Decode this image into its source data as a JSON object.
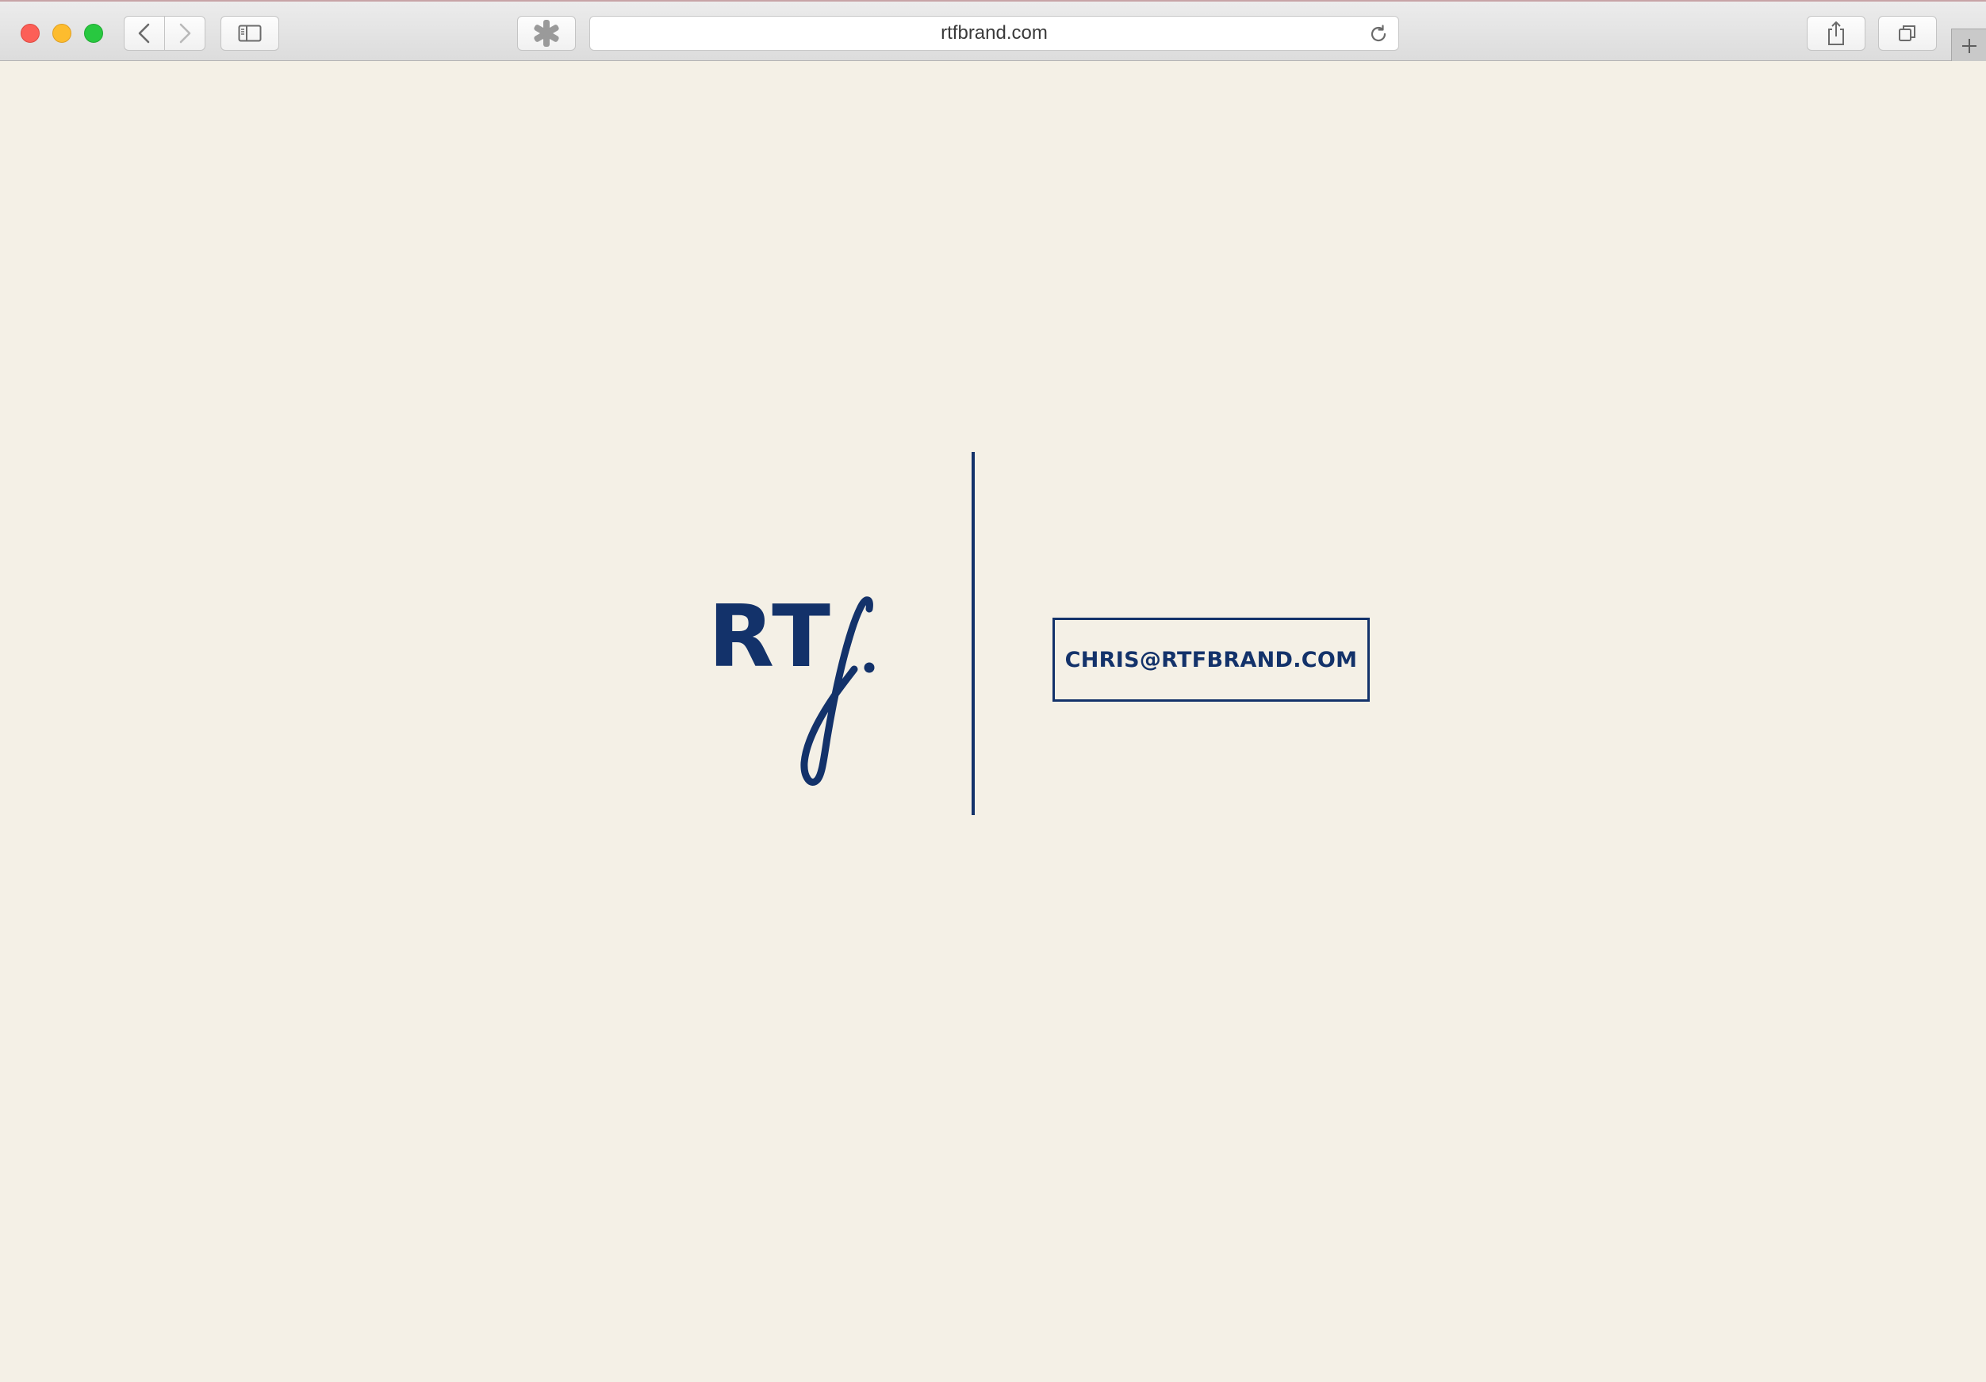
{
  "browser": {
    "url": "rtfbrand.com",
    "nav_icons": [
      "back-icon",
      "forward-icon",
      "sidebar-icon",
      "extension-icon",
      "reload-icon",
      "share-icon",
      "tabs-icon",
      "plus-icon"
    ]
  },
  "page": {
    "logo_text": "RT",
    "logo_script_letter": "f",
    "email_label": "CHRIS@RTFBRAND.COM"
  },
  "colors": {
    "brand_navy": "#13326a",
    "background": "#f4f0e6"
  }
}
